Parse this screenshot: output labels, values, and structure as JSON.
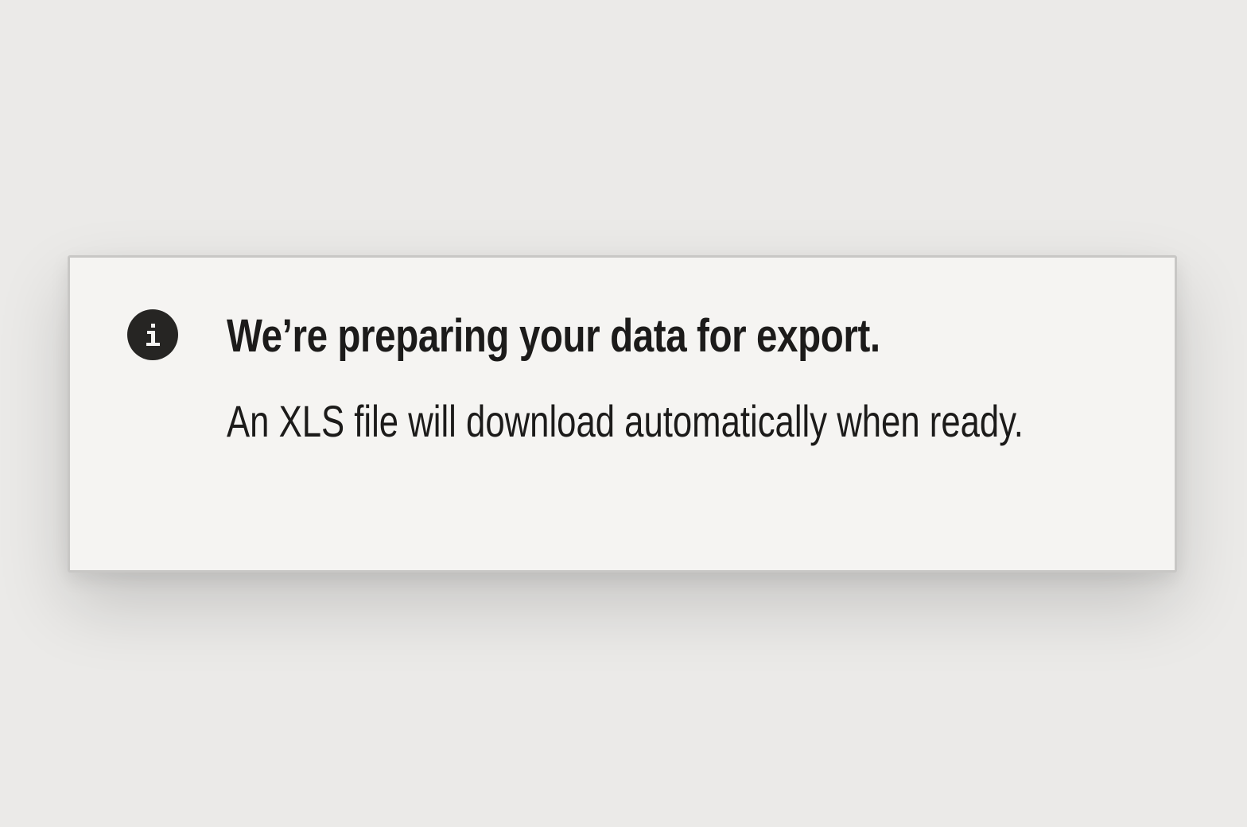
{
  "notification": {
    "type": "info",
    "icon": "info-icon",
    "title": "We’re preparing your data for export.",
    "message": "An XLS file will download automatically when ready."
  },
  "colors": {
    "page_background": "#ebeae8",
    "panel_background": "#f5f4f2",
    "panel_border": "#c8c7c5",
    "icon_fill": "#262523",
    "text": "#1c1b1a"
  }
}
